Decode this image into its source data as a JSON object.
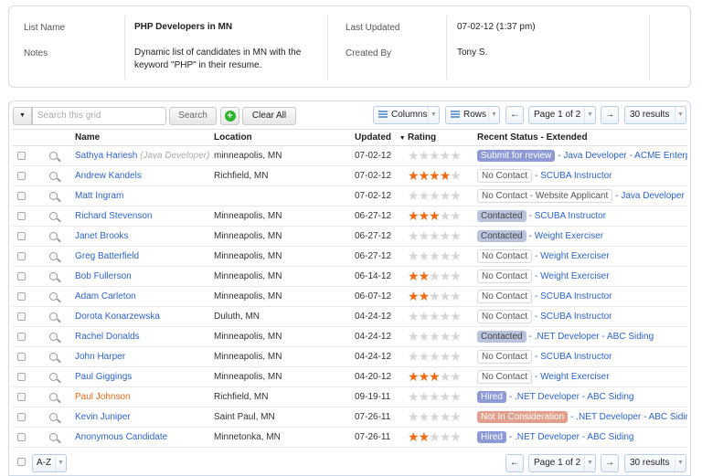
{
  "info": {
    "list_name_label": "List Name",
    "list_name": "PHP Developers in MN",
    "notes_label": "Notes",
    "notes": "Dynamic list of candidates in MN with the keyword \"PHP\" in their resume.",
    "last_updated_label": "Last Updated",
    "last_updated": "07-02-12 (1:37 pm)",
    "created_by_label": "Created By",
    "created_by": "Tony S."
  },
  "toolbar": {
    "search_placeholder": "Search this grid",
    "search_label": "Search",
    "clear_label": "Clear All",
    "columns_label": "Columns",
    "rows_label": "Rows",
    "prev": "←",
    "next": "→",
    "page": "Page 1 of 2",
    "results": "30 results"
  },
  "columns": [
    "Name",
    "Location",
    "Updated",
    "Rating",
    "Recent Status - Extended"
  ],
  "rows": [
    {
      "name": "Sathya Hariesh",
      "role": "(Java Developer)",
      "location": "minneapolis, MN",
      "updated": "07-02-12",
      "rating": 0,
      "status": "Submit for review",
      "status_type": "submit",
      "extra": "- Java Developer - ACME Enterprises"
    },
    {
      "name": "Andrew Kandels",
      "location": "Richfield, MN",
      "updated": "07-02-12",
      "rating": 4,
      "status": "No Contact",
      "status_type": "nocontact",
      "extra": "- SCUBA Instructor"
    },
    {
      "name": "Matt Ingram",
      "location": "",
      "updated": "07-02-12",
      "rating": 0,
      "status": "No Contact - Website Applicant",
      "status_type": "nocontact",
      "extra": "- Java Developer - ACME"
    },
    {
      "name": "Richard Stevenson",
      "location": "Minneapolis, MN",
      "updated": "06-27-12",
      "rating": 3,
      "status": "Contacted",
      "status_type": "contacted",
      "extra": "- SCUBA Instructor"
    },
    {
      "name": "Janet Brooks",
      "location": "Minneapolis, MN",
      "updated": "06-27-12",
      "rating": 0,
      "status": "Contacted",
      "status_type": "contacted",
      "extra": "- Weight Exerciser"
    },
    {
      "name": "Greg Batterfield",
      "location": "Minneapolis, MN",
      "updated": "06-27-12",
      "rating": 0,
      "status": "No Contact",
      "status_type": "nocontact",
      "extra": "- Weight Exerciser"
    },
    {
      "name": "Bob Fullerson",
      "location": "Minneapolis, MN",
      "updated": "06-14-12",
      "rating": 2,
      "status": "No Contact",
      "status_type": "nocontact",
      "extra": "- Weight Exerciser"
    },
    {
      "name": "Adam Carleton",
      "location": "Minneapolis, MN",
      "updated": "06-07-12",
      "rating": 2,
      "status": "No Contact",
      "status_type": "nocontact",
      "extra": "- SCUBA Instructor"
    },
    {
      "name": "Dorota Konarzewska",
      "location": "Duluth, MN",
      "updated": "04-24-12",
      "rating": 0,
      "status": "No Contact",
      "status_type": "nocontact",
      "extra": "- SCUBA Instructor"
    },
    {
      "name": "Rachel Donalds",
      "location": "Minneapolis, MN",
      "updated": "04-24-12",
      "rating": 0,
      "status": "Contacted",
      "status_type": "contacted",
      "extra": "- .NET Developer - ABC Siding"
    },
    {
      "name": "John Harper",
      "location": "Minneapolis, MN",
      "updated": "04-24-12",
      "rating": 0,
      "status": "No Contact",
      "status_type": "nocontact",
      "extra": "- SCUBA Instructor"
    },
    {
      "name": "Paul Giggings",
      "location": "Minneapolis, MN",
      "updated": "04-20-12",
      "rating": 3,
      "status": "No Contact",
      "status_type": "nocontact",
      "extra": "- Weight Exerciser"
    },
    {
      "name": "Paul Johnson",
      "highlight": true,
      "location": "Richfield, MN",
      "updated": "09-19-11",
      "rating": 0,
      "status": "Hired",
      "status_type": "hired",
      "extra": "- .NET Developer - ABC Siding"
    },
    {
      "name": "Kevin Juniper",
      "location": "Saint Paul, MN",
      "updated": "07-26-11",
      "rating": 0,
      "status": "Not In Consideration",
      "status_type": "notin",
      "extra": "- .NET Developer - ABC Siding"
    },
    {
      "name": "Anonymous Candidate",
      "location": "Minnetonka, MN",
      "updated": "07-26-11",
      "rating": 2,
      "status": "Hired",
      "status_type": "hired",
      "extra": "- .NET Developer - ABC Siding"
    }
  ],
  "footer": {
    "sort": "A-Z",
    "page": "Page 1 of 2",
    "results": "30 results",
    "prev": "←",
    "next": "→"
  },
  "colors": {
    "link": "#2e64c8",
    "star": "#f06a12",
    "highlight": "#e86a1a"
  }
}
